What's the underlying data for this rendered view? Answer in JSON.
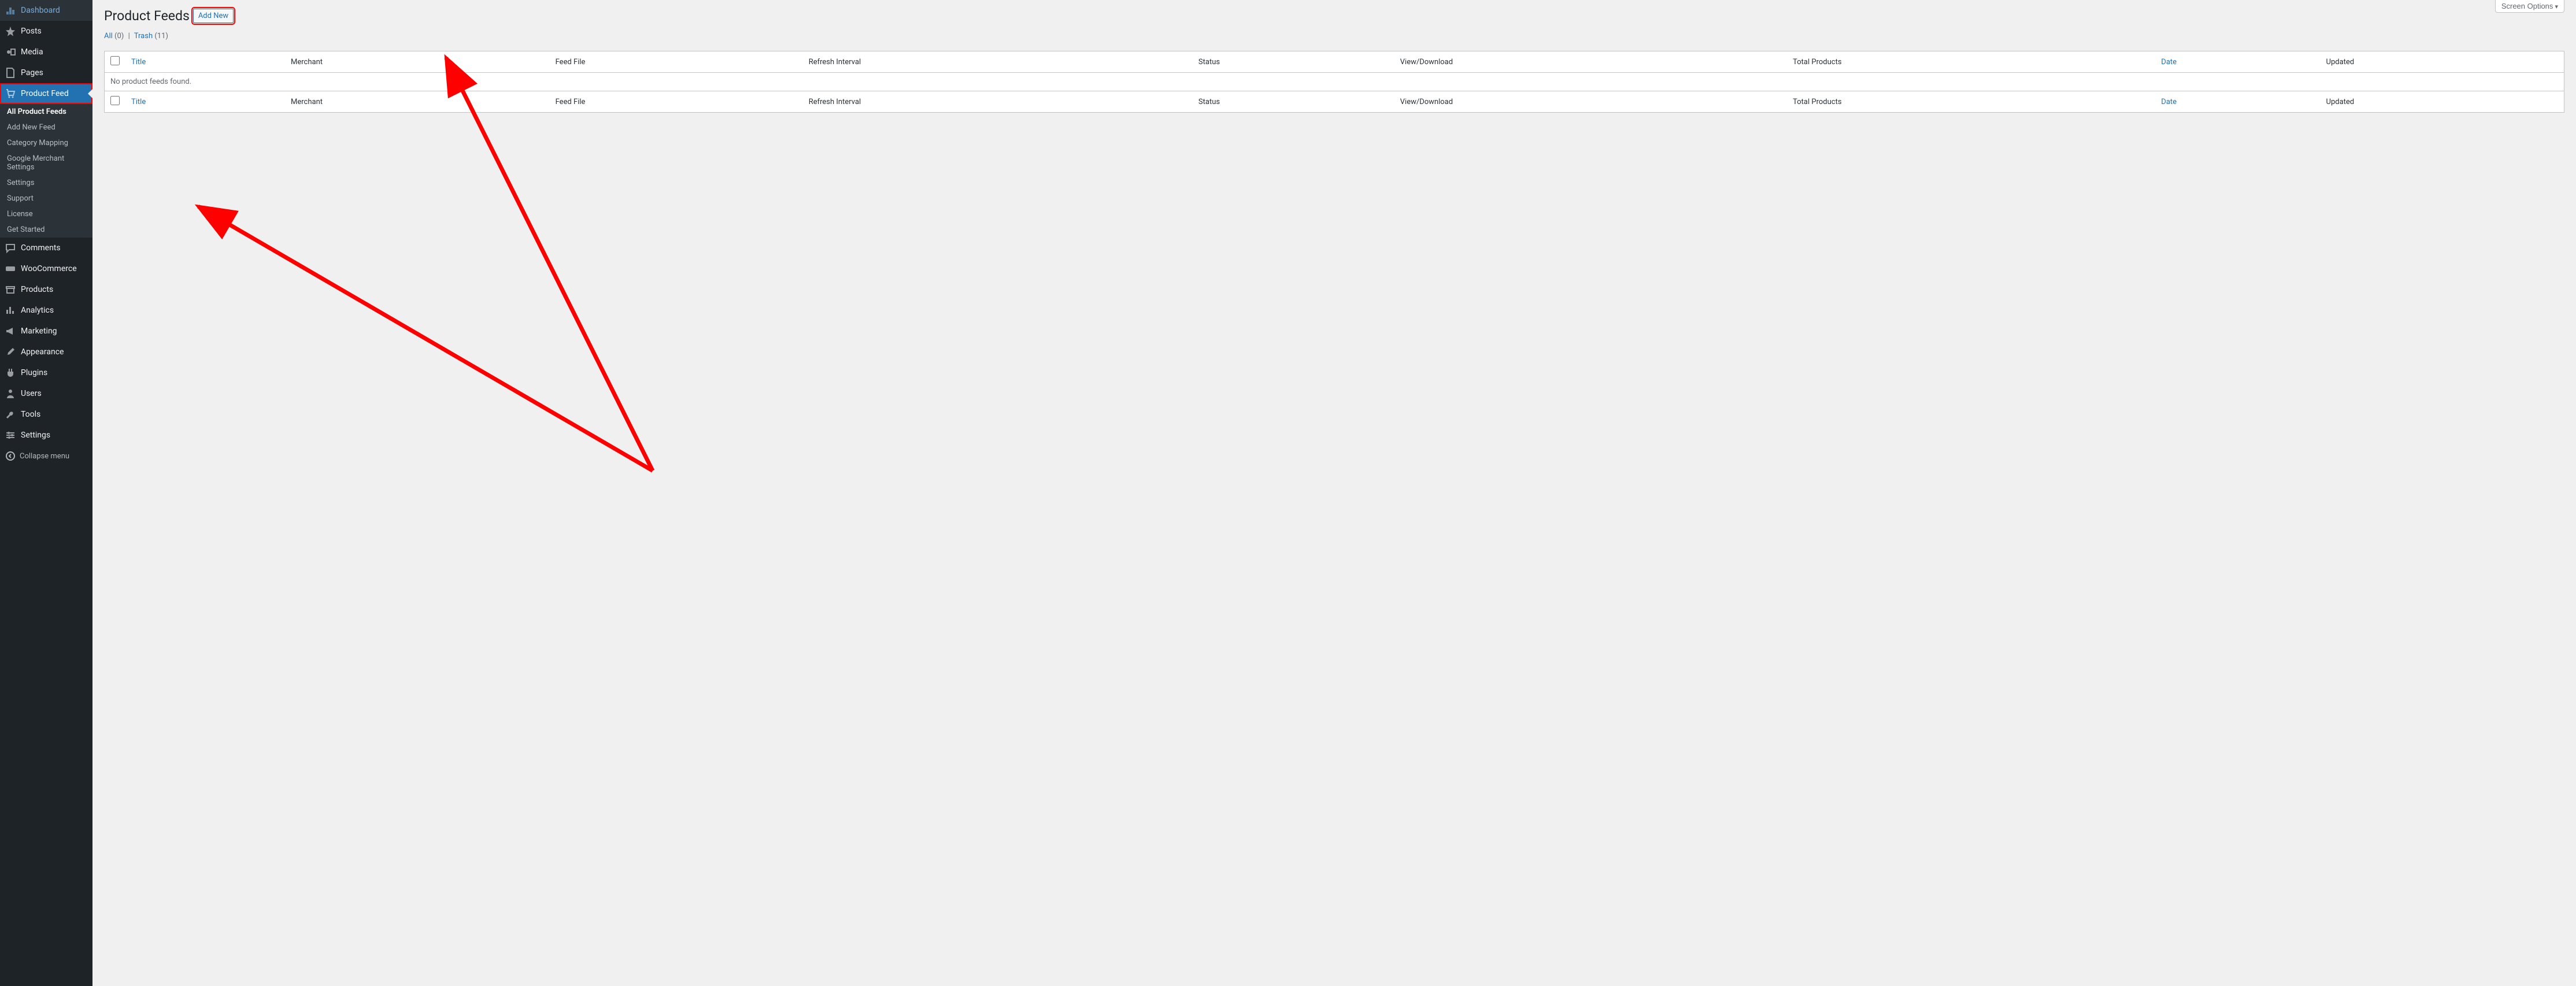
{
  "sidebar": {
    "items": [
      {
        "label": "Dashboard",
        "icon": "dashboard-icon"
      },
      {
        "label": "Posts",
        "icon": "pin-icon"
      },
      {
        "label": "Media",
        "icon": "media-icon"
      },
      {
        "label": "Pages",
        "icon": "page-icon"
      },
      {
        "label": "Product Feed",
        "icon": "cart-icon",
        "active": true,
        "highlighted": true
      },
      {
        "label": "Comments",
        "icon": "comment-icon"
      },
      {
        "label": "WooCommerce",
        "icon": "woo-icon"
      },
      {
        "label": "Products",
        "icon": "archive-icon"
      },
      {
        "label": "Analytics",
        "icon": "chart-icon"
      },
      {
        "label": "Marketing",
        "icon": "megaphone-icon"
      },
      {
        "label": "Appearance",
        "icon": "brush-icon"
      },
      {
        "label": "Plugins",
        "icon": "plug-icon"
      },
      {
        "label": "Users",
        "icon": "user-icon"
      },
      {
        "label": "Tools",
        "icon": "wrench-icon"
      },
      {
        "label": "Settings",
        "icon": "sliders-icon"
      }
    ],
    "submenu": [
      {
        "label": "All Product Feeds",
        "current": true
      },
      {
        "label": "Add New Feed"
      },
      {
        "label": "Category Mapping"
      },
      {
        "label": "Google Merchant Settings"
      },
      {
        "label": "Settings"
      },
      {
        "label": "Support"
      },
      {
        "label": "License"
      },
      {
        "label": "Get Started"
      }
    ],
    "collapse": "Collapse menu"
  },
  "header": {
    "title": "Product Feeds",
    "add_new": "Add New",
    "screen_options": "Screen Options"
  },
  "filters": {
    "all_label": "All",
    "all_count": "(0)",
    "trash_label": "Trash",
    "trash_count": "(11)"
  },
  "table": {
    "columns": [
      "Title",
      "Merchant",
      "Feed File",
      "Refresh Interval",
      "Status",
      "View/Download",
      "Total Products",
      "Date",
      "Updated"
    ],
    "sortable": {
      "0": true,
      "7": true
    },
    "empty_message": "No product feeds found."
  },
  "annotations": {
    "arrow_color": "#ff0000"
  }
}
